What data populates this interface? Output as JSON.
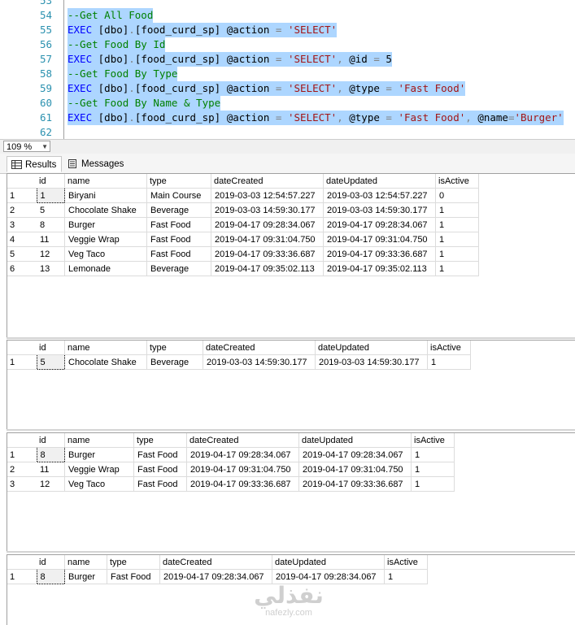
{
  "editor": {
    "lines": [
      {
        "num": "53",
        "parts": []
      },
      {
        "num": "54",
        "parts": [
          {
            "cls": "cm",
            "text": "--Get All Food"
          }
        ]
      },
      {
        "num": "55",
        "parts": [
          {
            "cls": "kw",
            "text": "EXEC "
          },
          {
            "cls": "id",
            "text": "[dbo]"
          },
          {
            "cls": "op",
            "text": "."
          },
          {
            "cls": "id",
            "text": "[food_curd_sp] @action "
          },
          {
            "cls": "op",
            "text": "= "
          },
          {
            "cls": "str",
            "text": "'SELECT'"
          }
        ]
      },
      {
        "num": "56",
        "parts": [
          {
            "cls": "cm",
            "text": "--Get Food By Id"
          }
        ]
      },
      {
        "num": "57",
        "parts": [
          {
            "cls": "kw",
            "text": "EXEC "
          },
          {
            "cls": "id",
            "text": "[dbo]"
          },
          {
            "cls": "op",
            "text": "."
          },
          {
            "cls": "id",
            "text": "[food_curd_sp] @action "
          },
          {
            "cls": "op",
            "text": "= "
          },
          {
            "cls": "str",
            "text": "'SELECT'"
          },
          {
            "cls": "op",
            "text": ", "
          },
          {
            "cls": "id",
            "text": "@id "
          },
          {
            "cls": "op",
            "text": "= "
          },
          {
            "cls": "id",
            "text": "5"
          }
        ]
      },
      {
        "num": "58",
        "parts": [
          {
            "cls": "cm",
            "text": "--Get Food By Type"
          }
        ]
      },
      {
        "num": "59",
        "parts": [
          {
            "cls": "kw",
            "text": "EXEC "
          },
          {
            "cls": "id",
            "text": "[dbo]"
          },
          {
            "cls": "op",
            "text": "."
          },
          {
            "cls": "id",
            "text": "[food_curd_sp] @action "
          },
          {
            "cls": "op",
            "text": "= "
          },
          {
            "cls": "str",
            "text": "'SELECT'"
          },
          {
            "cls": "op",
            "text": ", "
          },
          {
            "cls": "id",
            "text": "@type "
          },
          {
            "cls": "op",
            "text": "= "
          },
          {
            "cls": "str",
            "text": "'Fast Food'"
          }
        ]
      },
      {
        "num": "60",
        "parts": [
          {
            "cls": "cm",
            "text": "--Get Food By Name & Type"
          }
        ]
      },
      {
        "num": "61",
        "parts": [
          {
            "cls": "kw",
            "text": "EXEC "
          },
          {
            "cls": "id",
            "text": "[dbo]"
          },
          {
            "cls": "op",
            "text": "."
          },
          {
            "cls": "id",
            "text": "[food_curd_sp] @action "
          },
          {
            "cls": "op",
            "text": "= "
          },
          {
            "cls": "str",
            "text": "'SELECT'"
          },
          {
            "cls": "op",
            "text": ", "
          },
          {
            "cls": "id",
            "text": "@type "
          },
          {
            "cls": "op",
            "text": "= "
          },
          {
            "cls": "str",
            "text": "'Fast Food'"
          },
          {
            "cls": "op",
            "text": ", "
          },
          {
            "cls": "id",
            "text": "@name"
          },
          {
            "cls": "op",
            "text": "="
          },
          {
            "cls": "str",
            "text": "'Burger'"
          }
        ]
      },
      {
        "num": "62",
        "parts": []
      }
    ]
  },
  "zoom": {
    "value": "109 %"
  },
  "tabs": {
    "results": "Results",
    "messages": "Messages"
  },
  "columns": [
    "id",
    "name",
    "type",
    "dateCreated",
    "dateUpdated",
    "isActive"
  ],
  "results": [
    {
      "rows": [
        [
          "1",
          "Biryani",
          "Main Course",
          "2019-03-03 12:54:57.227",
          "2019-03-03 12:54:57.227",
          "0"
        ],
        [
          "5",
          "Chocolate Shake",
          "Beverage",
          "2019-03-03 14:59:30.177",
          "2019-03-03 14:59:30.177",
          "1"
        ],
        [
          "8",
          "Burger",
          "Fast Food",
          "2019-04-17 09:28:34.067",
          "2019-04-17 09:28:34.067",
          "1"
        ],
        [
          "11",
          "Veggie Wrap",
          "Fast Food",
          "2019-04-17 09:31:04.750",
          "2019-04-17 09:31:04.750",
          "1"
        ],
        [
          "12",
          "Veg Taco",
          "Fast Food",
          "2019-04-17 09:33:36.687",
          "2019-04-17 09:33:36.687",
          "1"
        ],
        [
          "13",
          "Lemonade",
          "Beverage",
          "2019-04-17 09:35:02.113",
          "2019-04-17 09:35:02.113",
          "1"
        ]
      ]
    },
    {
      "rows": [
        [
          "5",
          "Chocolate Shake",
          "Beverage",
          "2019-03-03 14:59:30.177",
          "2019-03-03 14:59:30.177",
          "1"
        ]
      ]
    },
    {
      "rows": [
        [
          "8",
          "Burger",
          "Fast Food",
          "2019-04-17 09:28:34.067",
          "2019-04-17 09:28:34.067",
          "1"
        ],
        [
          "11",
          "Veggie Wrap",
          "Fast Food",
          "2019-04-17 09:31:04.750",
          "2019-04-17 09:31:04.750",
          "1"
        ],
        [
          "12",
          "Veg Taco",
          "Fast Food",
          "2019-04-17 09:33:36.687",
          "2019-04-17 09:33:36.687",
          "1"
        ]
      ]
    },
    {
      "rows": [
        [
          "8",
          "Burger",
          "Fast Food",
          "2019-04-17 09:28:34.067",
          "2019-04-17 09:28:34.067",
          "1"
        ]
      ]
    }
  ],
  "watermark": {
    "arabic": "نفذلي",
    "latin": "nafezly.com"
  }
}
